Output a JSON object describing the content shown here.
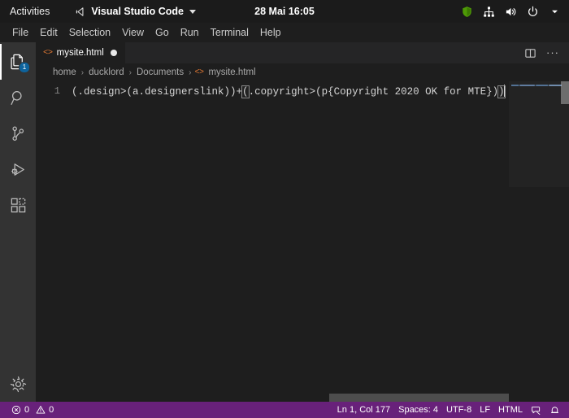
{
  "desktop": {
    "activities_label": "Activities",
    "app_menu": {
      "name": "Visual Studio Code",
      "icon": "vscode-logo-icon",
      "caret": "chevron-down-icon"
    },
    "clock": "28 Mai  16:05",
    "tray": [
      {
        "name": "shield-icon",
        "color": "#4e9a06"
      },
      {
        "name": "network-icon",
        "color": "#ffffff"
      },
      {
        "name": "volume-icon",
        "color": "#ffffff"
      },
      {
        "name": "power-icon",
        "color": "#ffffff"
      },
      {
        "name": "chevron-down-icon",
        "color": "#ffffff"
      }
    ]
  },
  "menubar": {
    "items": [
      {
        "label": "File"
      },
      {
        "label": "Edit"
      },
      {
        "label": "Selection"
      },
      {
        "label": "View"
      },
      {
        "label": "Go"
      },
      {
        "label": "Run"
      },
      {
        "label": "Terminal"
      },
      {
        "label": "Help"
      }
    ]
  },
  "activitybar": {
    "items": [
      {
        "name": "explorer-icon",
        "label": "Explorer",
        "active": true,
        "badge": "1"
      },
      {
        "name": "search-icon",
        "label": "Search",
        "active": false,
        "badge": ""
      },
      {
        "name": "source-control-icon",
        "label": "Source Control",
        "active": false,
        "badge": ""
      },
      {
        "name": "run-debug-icon",
        "label": "Run and Debug",
        "active": false,
        "badge": ""
      },
      {
        "name": "extensions-icon",
        "label": "Extensions",
        "active": false,
        "badge": ""
      }
    ],
    "bottom": [
      {
        "name": "gear-icon",
        "label": "Manage"
      }
    ]
  },
  "tabs": {
    "active_tab": {
      "icon": "html-file-icon",
      "icon_glyph": "<>",
      "label": "mysite.html",
      "dirty": true
    },
    "actions": [
      {
        "name": "split-editor-icon",
        "label": "Split Editor"
      },
      {
        "name": "more-actions-icon",
        "label": "More Actions...",
        "glyph": "···"
      }
    ]
  },
  "breadcrumb": {
    "separator": "›",
    "items": [
      {
        "label": "home",
        "icon": ""
      },
      {
        "label": "ducklord",
        "icon": ""
      },
      {
        "label": "Documents",
        "icon": ""
      },
      {
        "label": "mysite.html",
        "icon": "html-file-icon",
        "icon_glyph": "<>"
      }
    ]
  },
  "editor": {
    "line_numbers": [
      "1"
    ],
    "code": {
      "before_bracket": "(.design>(a.designerslink))+",
      "open_bracket": "(",
      "middle": ".copyright>(p{Copyright 2020 OK for MTE})",
      "close_bracket": ")",
      "full_text": "(.design>(a.designerslink))+(.copyright>(p{Copyright 2020 OK for MTE}))"
    }
  },
  "statusbar": {
    "left": [
      {
        "name": "error-count",
        "icon": "error-icon",
        "value": "0"
      },
      {
        "name": "warning-count",
        "icon": "warning-icon",
        "value": "0"
      }
    ],
    "right": [
      {
        "name": "cursor-position",
        "label": "Ln 1, Col 177"
      },
      {
        "name": "indentation",
        "label": "Spaces: 4"
      },
      {
        "name": "encoding",
        "label": "UTF-8"
      },
      {
        "name": "line-endings",
        "label": "LF"
      },
      {
        "name": "language-mode",
        "label": "HTML"
      }
    ],
    "icons": [
      {
        "name": "feedback-icon"
      },
      {
        "name": "notifications-bell-icon"
      }
    ],
    "background": "#68217a"
  }
}
